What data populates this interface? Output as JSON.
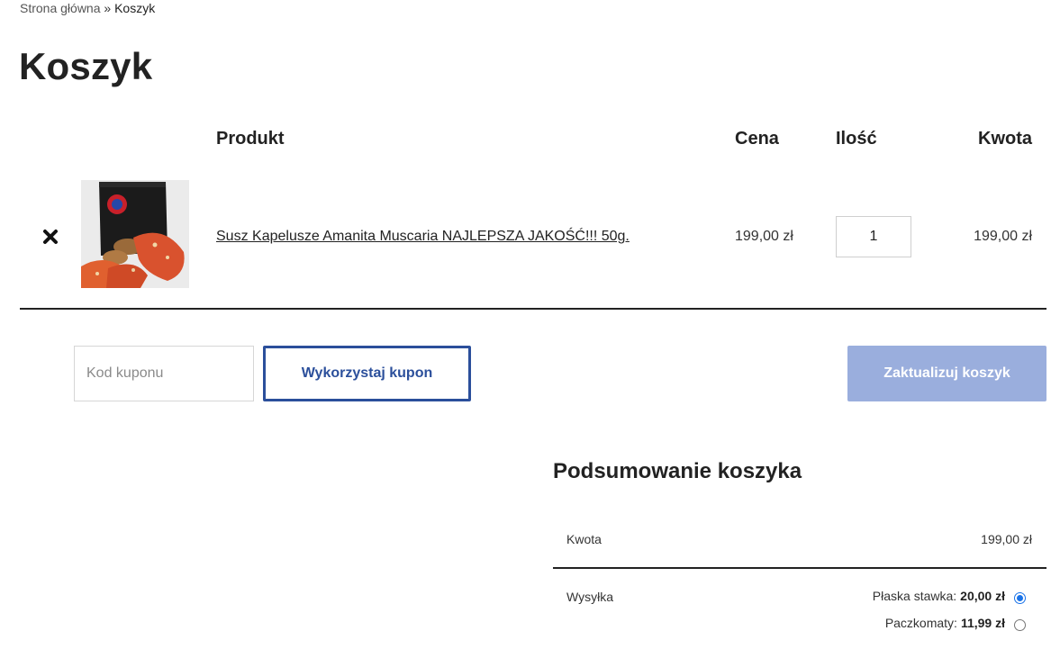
{
  "breadcrumb": {
    "home": "Strona główna",
    "separator": "»",
    "current": "Koszyk"
  },
  "page_title": "Koszyk",
  "table": {
    "headers": {
      "product": "Produkt",
      "price": "Cena",
      "quantity": "Ilość",
      "total": "Kwota"
    },
    "items": [
      {
        "name": "Susz Kapelusze Amanita Muscaria NAJLEPSZA JAKOŚĆ!!! 50g.",
        "price": "199,00 zł",
        "quantity": "1",
        "total": "199,00 zł",
        "remove_icon": "close-x-icon"
      }
    ]
  },
  "coupon": {
    "placeholder": "Kod kuponu",
    "apply_label": "Wykorzystaj kupon"
  },
  "update_label": "Zaktualizuj koszyk",
  "summary": {
    "title": "Podsumowanie koszyka",
    "subtotal_label": "Kwota",
    "subtotal_value": "199,00 zł",
    "shipping_label": "Wysyłka",
    "shipping_options": [
      {
        "label": "Płaska stawka:",
        "amount": "20,00 zł",
        "selected": true
      },
      {
        "label": "Paczkomaty:",
        "amount": "11,99 zł",
        "selected": false
      }
    ]
  },
  "colors": {
    "accent": "#2b4f9b",
    "update_button": "#9aaedd",
    "radio_checked": "#1a73e8"
  }
}
